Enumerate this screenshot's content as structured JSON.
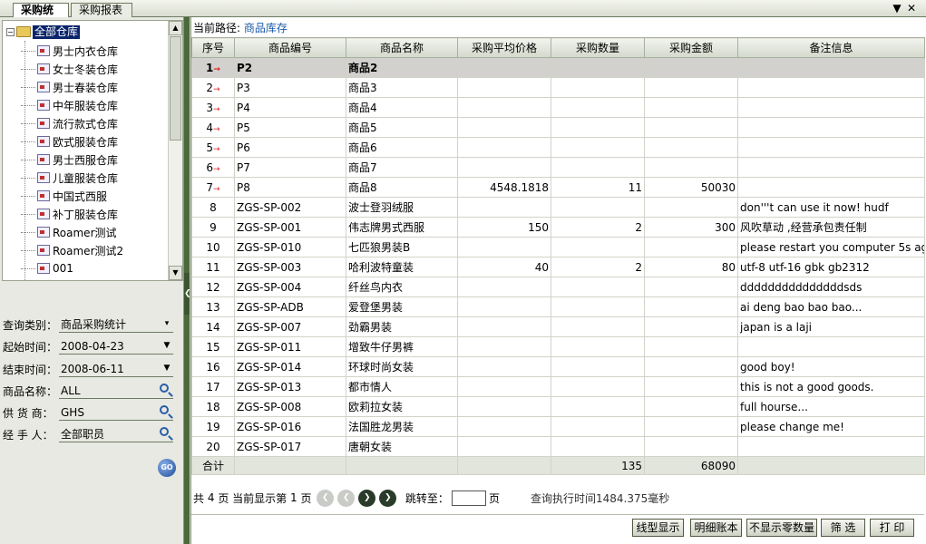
{
  "tabs": [
    {
      "label": "采购统计",
      "active": true
    },
    {
      "label": "采购报表",
      "active": false
    }
  ],
  "window_controls": {
    "menu": "▼",
    "close": "✕"
  },
  "tree": {
    "root_label": "全部仓库",
    "root_expander": "−",
    "items": [
      "男士内衣仓库",
      "女士冬装仓库",
      "男士春装仓库",
      "中年服装仓库",
      "流行款式仓库",
      "欧式服装仓库",
      "男士西服仓库",
      "儿童服装仓库",
      "中国式西服",
      "补丁服装仓库",
      "Roamer测试",
      "Roamer测试2",
      "001"
    ]
  },
  "filters": [
    {
      "label": "查询类别：",
      "value": "商品采购统计",
      "control": "▾"
    },
    {
      "label": "起始时间：",
      "value": "2008-04-23",
      "control": "▼"
    },
    {
      "label": "结束时间：",
      "value": "2008-06-11",
      "control": "▼"
    },
    {
      "label": "商品名称：",
      "value": "ALL",
      "control": "search"
    },
    {
      "label": "供 货 商：",
      "value": "GHS",
      "control": "search"
    },
    {
      "label": "经 手 人：",
      "value": "全部职员",
      "control": "search"
    }
  ],
  "go_button": "GO",
  "path": {
    "label": "当前路径:",
    "link": "商品库存"
  },
  "table": {
    "headers": [
      "序号",
      "商品编号",
      "商品名称",
      "采购平均价格",
      "采购数量",
      "采购金额",
      "备注信息"
    ],
    "rows": [
      [
        "1",
        "P2",
        "商品2",
        "",
        "",
        "",
        ""
      ],
      [
        "2",
        "P3",
        "商品3",
        "",
        "",
        "",
        ""
      ],
      [
        "3",
        "P4",
        "商品4",
        "",
        "",
        "",
        ""
      ],
      [
        "4",
        "P5",
        "商品5",
        "",
        "",
        "",
        ""
      ],
      [
        "5",
        "P6",
        "商品6",
        "",
        "",
        "",
        ""
      ],
      [
        "6",
        "P7",
        "商品7",
        "",
        "",
        "",
        ""
      ],
      [
        "7",
        "P8",
        "商品8",
        "4548.1818",
        "11",
        "50030",
        ""
      ],
      [
        "8",
        "ZGS-SP-002",
        "波士登羽绒服",
        "",
        "",
        "",
        "don'''t can use it now! hudf"
      ],
      [
        "9",
        "ZGS-SP-001",
        "伟志牌男式西服",
        "150",
        "2",
        "300",
        "风吹草动 ,经营承包责任制"
      ],
      [
        "10",
        "ZGS-SP-010",
        "七匹狼男装B",
        "",
        "",
        "",
        "please restart you computer 5s ago.."
      ],
      [
        "11",
        "ZGS-SP-003",
        "哈利波特童装",
        "40",
        "2",
        "80",
        "utf-8 utf-16 gbk gb2312"
      ],
      [
        "12",
        "ZGS-SP-004",
        "纤丝鸟内衣",
        "",
        "",
        "",
        "dddddddddddddddsds"
      ],
      [
        "13",
        "ZGS-SP-ADB",
        "爱登堡男装",
        "",
        "",
        "",
        "ai deng bao bao bao..."
      ],
      [
        "14",
        "ZGS-SP-007",
        "劲霸男装",
        "",
        "",
        "",
        "japan is a laji"
      ],
      [
        "15",
        "ZGS-SP-011",
        "增致牛仔男裤",
        "",
        "",
        "",
        ""
      ],
      [
        "16",
        "ZGS-SP-014",
        "环球时尚女装",
        "",
        "",
        "",
        "good boy!"
      ],
      [
        "17",
        "ZGS-SP-013",
        "都市情人",
        "",
        "",
        "",
        "this is not a good goods."
      ],
      [
        "18",
        "ZGS-SP-008",
        "欧莉拉女装",
        "",
        "",
        "",
        "full hourse..."
      ],
      [
        "19",
        "ZGS-SP-016",
        "法国胜龙男装",
        "",
        "",
        "",
        "please change me!"
      ],
      [
        "20",
        "ZGS-SP-017",
        "唐朝女装",
        "",
        "",
        "",
        ""
      ]
    ],
    "row_marker": "→",
    "total": {
      "label": "合计",
      "qty": "135",
      "amount": "68090"
    }
  },
  "pager": {
    "prefix": "共",
    "pages": "4",
    "mid": "页 当前显示第",
    "current": "1",
    "suffix": "页",
    "jump_label": "跳转至：",
    "jump_suffix": "页",
    "timing_label": "查询执行时间",
    "timing_value": "1484.375",
    "timing_unit": "毫秒"
  },
  "actions": [
    "线型显示",
    "明细账本",
    "不显示零数量",
    "筛 选",
    "打 印"
  ]
}
